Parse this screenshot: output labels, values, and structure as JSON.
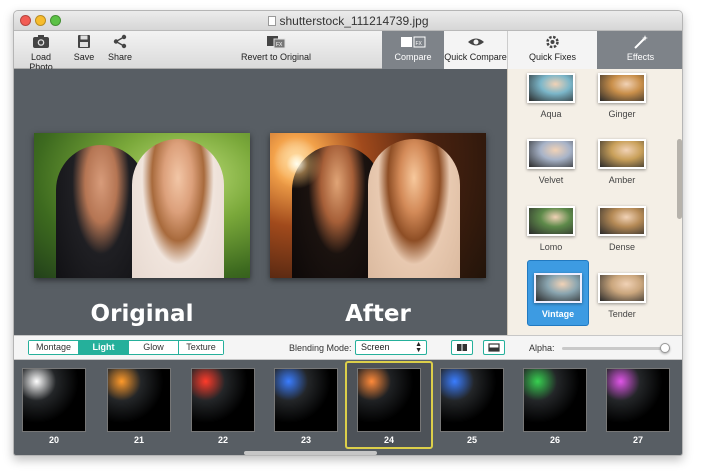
{
  "window": {
    "title": "shutterstock_111214739.jpg"
  },
  "toolbar": {
    "load_photo": "Load Photo",
    "save": "Save",
    "share": "Share",
    "revert": "Revert to Original",
    "compare": "Compare",
    "quick_compare": "Quick Compare",
    "quick_fixes": "Quick Fixes",
    "effects": "Effects"
  },
  "canvas": {
    "original_label": "Original",
    "after_label": "After"
  },
  "effects_panel": {
    "items": [
      {
        "name": "Aqua",
        "selected": false,
        "tint": "#7bb6c9"
      },
      {
        "name": "Ginger",
        "selected": false,
        "tint": "#c98f4a"
      },
      {
        "name": "Velvet",
        "selected": false,
        "tint": "#a7b3c8"
      },
      {
        "name": "Amber",
        "selected": false,
        "tint": "#c9a05a"
      },
      {
        "name": "Lomo",
        "selected": false,
        "tint": "#5e8a4a"
      },
      {
        "name": "Dense",
        "selected": false,
        "tint": "#b58a56"
      },
      {
        "name": "Vintage",
        "selected": true,
        "tint": "#8aa5b0"
      },
      {
        "name": "Tender",
        "selected": false,
        "tint": "#caa67d"
      }
    ]
  },
  "controls": {
    "tabs": [
      {
        "label": "Montage",
        "active": false
      },
      {
        "label": "Light",
        "active": true
      },
      {
        "label": "Glow",
        "active": false
      },
      {
        "label": "Texture",
        "active": false
      }
    ],
    "blending_mode_label": "Blending Mode:",
    "blending_mode_value": "Screen",
    "alpha_label": "Alpha:",
    "alpha_value": 1.0
  },
  "light_strip": {
    "items": [
      {
        "number": "20",
        "glow": "#ffffff",
        "selected": false
      },
      {
        "number": "21",
        "glow": "#ff9a2a",
        "selected": false
      },
      {
        "number": "22",
        "glow": "#ff3b2a",
        "selected": false
      },
      {
        "number": "23",
        "glow": "#3a7dff",
        "selected": false
      },
      {
        "number": "24",
        "glow": "#ff8a3a",
        "selected": true
      },
      {
        "number": "25",
        "glow": "#3a7dff",
        "selected": false
      },
      {
        "number": "26",
        "glow": "#37d050",
        "selected": false
      },
      {
        "number": "27",
        "glow": "#e055e8",
        "selected": false
      }
    ]
  },
  "colors": {
    "accent": "#25b09b",
    "selection_blue": "#3d9be2",
    "selection_gold": "#dccf4a",
    "canvas_bg": "#585e64"
  }
}
